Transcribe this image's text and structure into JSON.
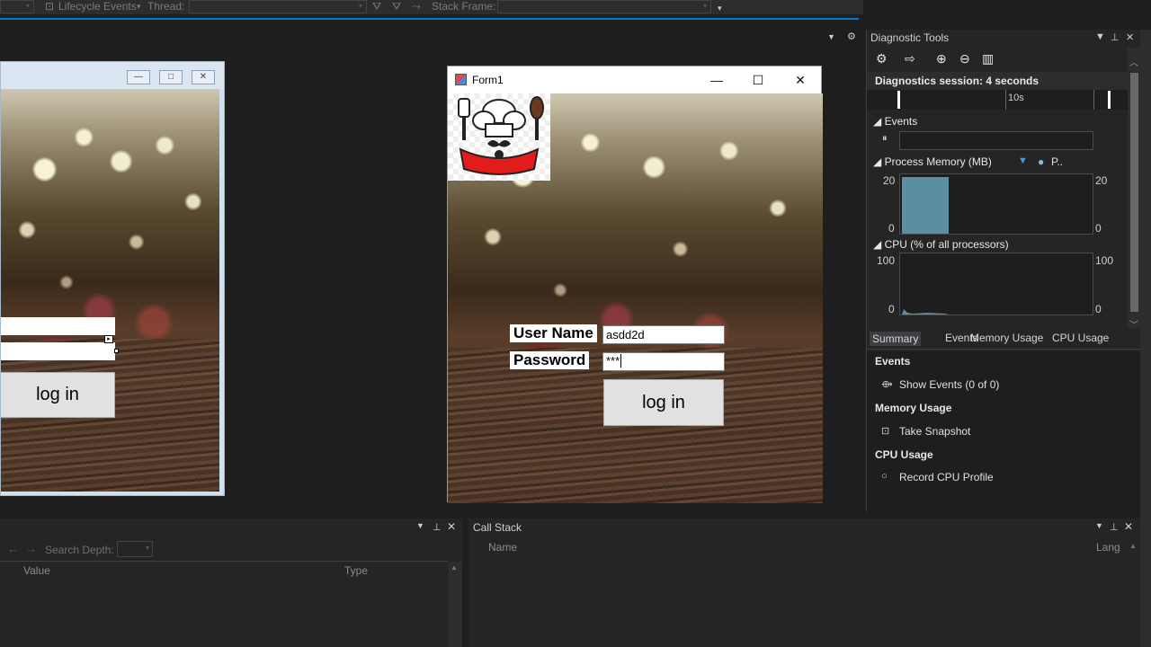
{
  "toolbar": {
    "lifecycle_label": "Lifecycle Events",
    "thread_label": "Thread:",
    "stack_frame_label": "Stack Frame:",
    "dropdown_glyph": "▾"
  },
  "designer": {
    "minimize_glyph": "—",
    "maximize_glyph": "□",
    "close_glyph": "✕",
    "login_label": "log in"
  },
  "form1": {
    "title": "Form1",
    "minimize_glyph": "—",
    "maximize_glyph": "☐",
    "close_glyph": "✕",
    "username_label": "User Name",
    "username_value": "asdd2d",
    "password_label": "Password",
    "password_value": "***",
    "login_label": "log in"
  },
  "diagnostics": {
    "title": "Diagnostic Tools",
    "session": "Diagnostics session: 4 seconds",
    "timeline_tick": "10s",
    "events_header": "Events",
    "memory_header": "Process Memory (MB)",
    "memory_legend": "P..",
    "memory_max": "20",
    "memory_min": "0",
    "memory_level": 0.95,
    "cpu_header": "CPU (% of all processors)",
    "cpu_max": "100",
    "cpu_min": "0",
    "tabs": [
      "Summary",
      "Events",
      "Memory Usage",
      "CPU Usage"
    ],
    "events_section": "Events",
    "show_events": "Show Events (0 of 0)",
    "memory_section": "Memory Usage",
    "take_snapshot": "Take Snapshot",
    "cpu_section": "CPU Usage",
    "record_cpu": "Record CPU Profile"
  },
  "locals": {
    "search_depth": "Search Depth:",
    "col_value": "Value",
    "col_type": "Type"
  },
  "callstack": {
    "title": "Call Stack",
    "col_name": "Name",
    "col_lang": "Lang"
  },
  "colors": {
    "accent": "#007acc",
    "vs_background": "#1e1e1e",
    "memory_fill": "#5a8fa3",
    "legend_blue": "#3d9fe0"
  }
}
